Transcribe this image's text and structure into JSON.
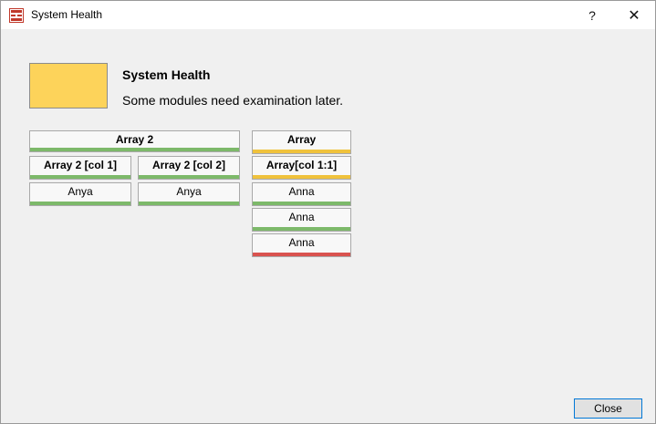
{
  "window": {
    "title": "System Health",
    "help": "?",
    "close": "✕"
  },
  "status": {
    "title": "System Health",
    "message": "Some modules need examination later.",
    "swatch_color": "#fdd35a"
  },
  "colors": {
    "ok": "#7db96a",
    "warn": "#f0c23c",
    "error": "#d9534f",
    "neutral": "#a6a6a6"
  },
  "array2": {
    "header": {
      "label": "Array 2",
      "status": "ok"
    },
    "columns": [
      {
        "label": "Array 2 [col 1]",
        "status": "ok",
        "cells": [
          {
            "label": "Anya",
            "status": "ok"
          }
        ]
      },
      {
        "label": "Array 2 [col 2]",
        "status": "ok",
        "cells": [
          {
            "label": "Anya",
            "status": "ok"
          }
        ]
      }
    ]
  },
  "array": {
    "header": {
      "label": "Array",
      "status": "warn"
    },
    "columns": [
      {
        "label": "Array[col 1:1]",
        "status": "warn",
        "cells": [
          {
            "label": "Anna",
            "status": "ok"
          },
          {
            "label": "Anna",
            "status": "ok"
          },
          {
            "label": "Anna",
            "status": "error"
          }
        ]
      }
    ]
  },
  "buttons": {
    "close": "Close"
  }
}
